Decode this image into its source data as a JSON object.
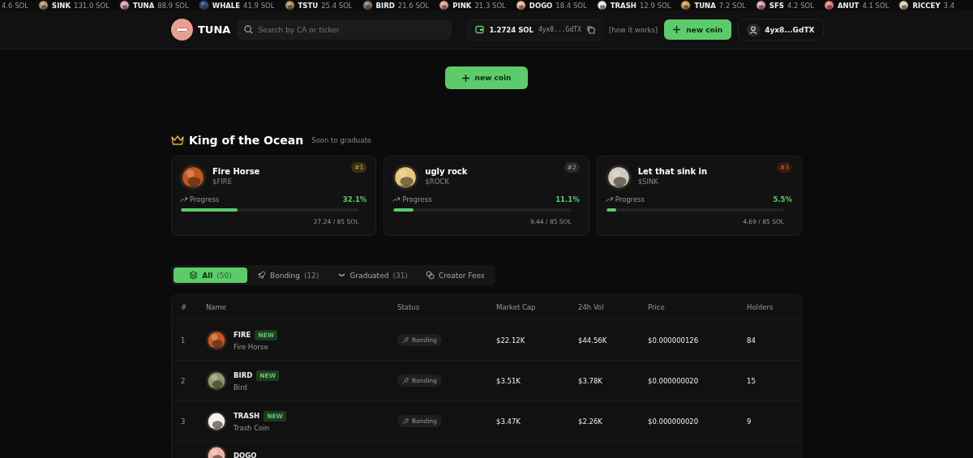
{
  "ticker": [
    {
      "amount": "4.6 SOL"
    },
    {
      "symbol": "SINK",
      "amount": "131.0 SOL",
      "color": "#b89a7a"
    },
    {
      "symbol": "TUNA",
      "amount": "88.9 SOL",
      "color": "#e9a3b3"
    },
    {
      "symbol": "WHALE",
      "amount": "41.9 SOL",
      "color": "#2a4f9a"
    },
    {
      "symbol": "TSTU",
      "amount": "25.4 SOL",
      "color": "#b9905a"
    },
    {
      "symbol": "BIRD",
      "amount": "21.6 SOL",
      "color": "#8a7a6a"
    },
    {
      "symbol": "PINK",
      "amount": "21.3 SOL",
      "color": "#eba295"
    },
    {
      "symbol": "DOGO",
      "amount": "18.4 SOL",
      "color": "#f0b7a0"
    },
    {
      "symbol": "TRASH",
      "amount": "12.9 SOL",
      "color": "#e8e8e8"
    },
    {
      "symbol": "TUNA",
      "amount": "7.2 SOL",
      "color": "#d9a45a"
    },
    {
      "symbol": "SFS",
      "amount": "4.2 SOL",
      "color": "#e0a0b0"
    },
    {
      "symbol": "ANUT",
      "amount": "4.1 SOL",
      "color": "#e88a8a"
    },
    {
      "symbol": "RICCEY",
      "amount": "3.4",
      "color": "#d9d2c0"
    }
  ],
  "header": {
    "brand": "TUNA",
    "search": {
      "placeholder": "Search by CA or ticker"
    },
    "balance": "1.2724 SOL",
    "wallet_short": "4yx8...GdTX",
    "how_it_works": "[how it works]",
    "new_coin": "new coin",
    "profile": "4yx8...GdTX"
  },
  "hero_button": "new coin",
  "king": {
    "title": "King of the Ocean",
    "subtitle": "Soon to graduate",
    "cards": [
      {
        "name": "Fire Horse",
        "ticker": "$FIRE",
        "rank": "#1",
        "progress_label": "Progress",
        "percent": "32.1%",
        "level": 0.321,
        "amount": "27.24 / 85 SOL",
        "color": "#c8561c"
      },
      {
        "name": "ugly rock",
        "ticker": "$ROCK",
        "rank": "#2",
        "progress_label": "Progress",
        "percent": "11.1%",
        "level": 0.111,
        "amount": "9.44 / 85 SOL",
        "color": "#e6c77a"
      },
      {
        "name": "Let that sink in",
        "ticker": "$SINK",
        "rank": "#3",
        "progress_label": "Progress",
        "percent": "5.5%",
        "level": 0.055,
        "amount": "4.69 / 85 SOL",
        "color": "#cfc8bd"
      }
    ]
  },
  "tabs": [
    {
      "label": "All",
      "count": "(50)",
      "selected": true
    },
    {
      "label": "Bonding",
      "count": "(12)",
      "selected": false
    },
    {
      "label": "Graduated",
      "count": "(31)",
      "selected": false
    },
    {
      "label": "Creator Fees",
      "selected": false
    }
  ],
  "table": {
    "columns": [
      "#",
      "Name",
      "Status",
      "Market Cap",
      "24h Vol",
      "Price",
      "Holders"
    ],
    "rows": [
      {
        "rank": "1",
        "symbol": "FIRE",
        "badge": "NEW",
        "name": "Fire Horse",
        "status": "Bonding",
        "market_cap": "$22.12K",
        "volume": "$44.56K",
        "price": "$0.000000126",
        "holders": "84",
        "color": "#c8561c"
      },
      {
        "rank": "2",
        "symbol": "BIRD",
        "badge": "NEW",
        "name": "Bird",
        "status": "Bonding",
        "market_cap": "$3.51K",
        "volume": "$3.78K",
        "price": "$0.000000020",
        "holders": "15",
        "color": "#8a9a6a"
      },
      {
        "rank": "3",
        "symbol": "TRASH",
        "badge": "NEW",
        "name": "Trash Coin",
        "status": "Bonding",
        "market_cap": "$3.47K",
        "volume": "$2.26K",
        "price": "$0.000000020",
        "holders": "9",
        "color": "#f0f0f0"
      },
      {
        "symbol": "DOGO",
        "color": "#f0b0a8"
      }
    ]
  }
}
